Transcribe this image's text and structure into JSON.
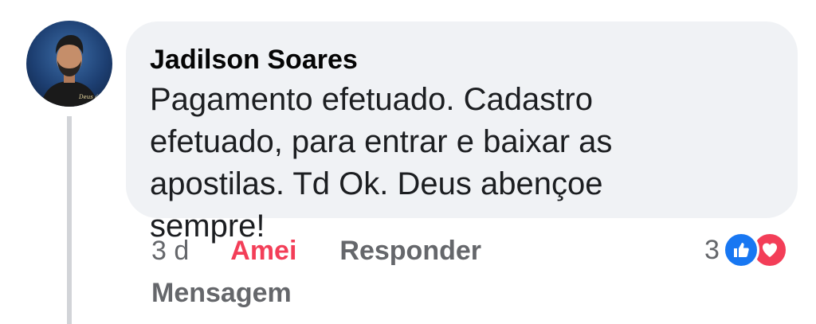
{
  "comment": {
    "author": "Jadilson Soares",
    "text": "Pagamento efetuado. Cadastro efetuado, para entrar e baixar as apostilas. Td Ok. Deus abençoe sempre!",
    "avatar_caption": "Deus é Fiel"
  },
  "actions": {
    "time": "3 d",
    "reaction_label": "Amei",
    "reply_label": "Responder",
    "message_label": "Mensagem"
  },
  "reactions": {
    "count": "3",
    "icons": [
      "like-icon",
      "love-icon"
    ]
  },
  "colors": {
    "bubble": "#f0f2f5",
    "love": "#f33e58",
    "like": "#1877f2",
    "muted": "#65676b"
  }
}
